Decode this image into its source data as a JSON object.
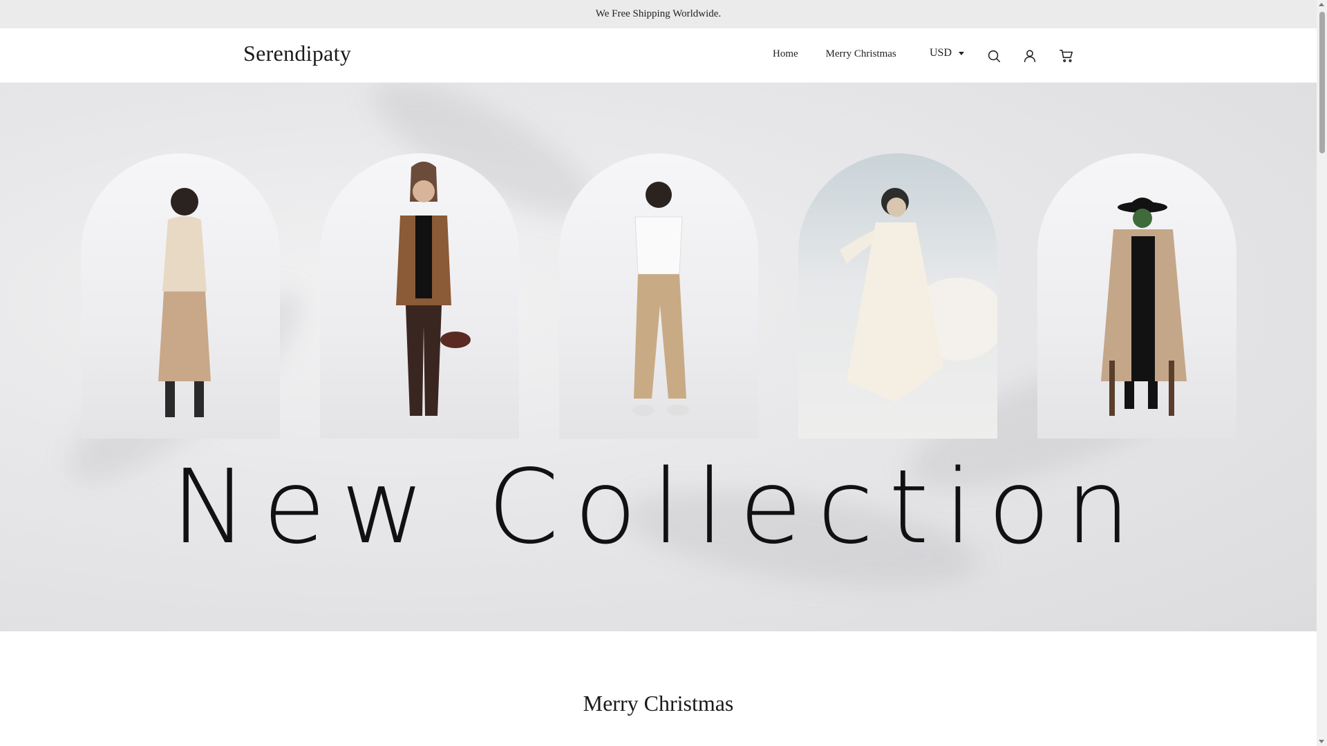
{
  "announcement": {
    "text": "We Free Shipping Worldwide."
  },
  "header": {
    "logo": "Serendipaty",
    "nav": [
      {
        "label": "Home"
      },
      {
        "label": "Merry Christmas"
      }
    ],
    "currency": "USD",
    "icons": {
      "search": "search-icon",
      "account": "account-icon",
      "cart": "cart-icon"
    }
  },
  "hero": {
    "title": "New Collection",
    "models": [
      {
        "name": "model-beige-knit-skirt",
        "outfit_colors": [
          "#e8d9c5",
          "#c8a888",
          "#2a2a2a"
        ]
      },
      {
        "name": "model-brown-leather-jacket",
        "outfit_colors": [
          "#8b5a37",
          "#111111",
          "#3a2621"
        ]
      },
      {
        "name": "model-white-tee-cargo",
        "outfit_colors": [
          "#fafafa",
          "#c8ab84",
          "#e0e0e0"
        ]
      },
      {
        "name": "model-white-dress",
        "outfit_colors": [
          "#f5efe3",
          "#2d2d2d",
          "#d9c6b0"
        ]
      },
      {
        "name": "model-trench-coat-hat",
        "outfit_colors": [
          "#c4a788",
          "#121212",
          "#5a3d2b"
        ]
      }
    ]
  },
  "sections": [
    {
      "title": "Merry Christmas"
    }
  ]
}
